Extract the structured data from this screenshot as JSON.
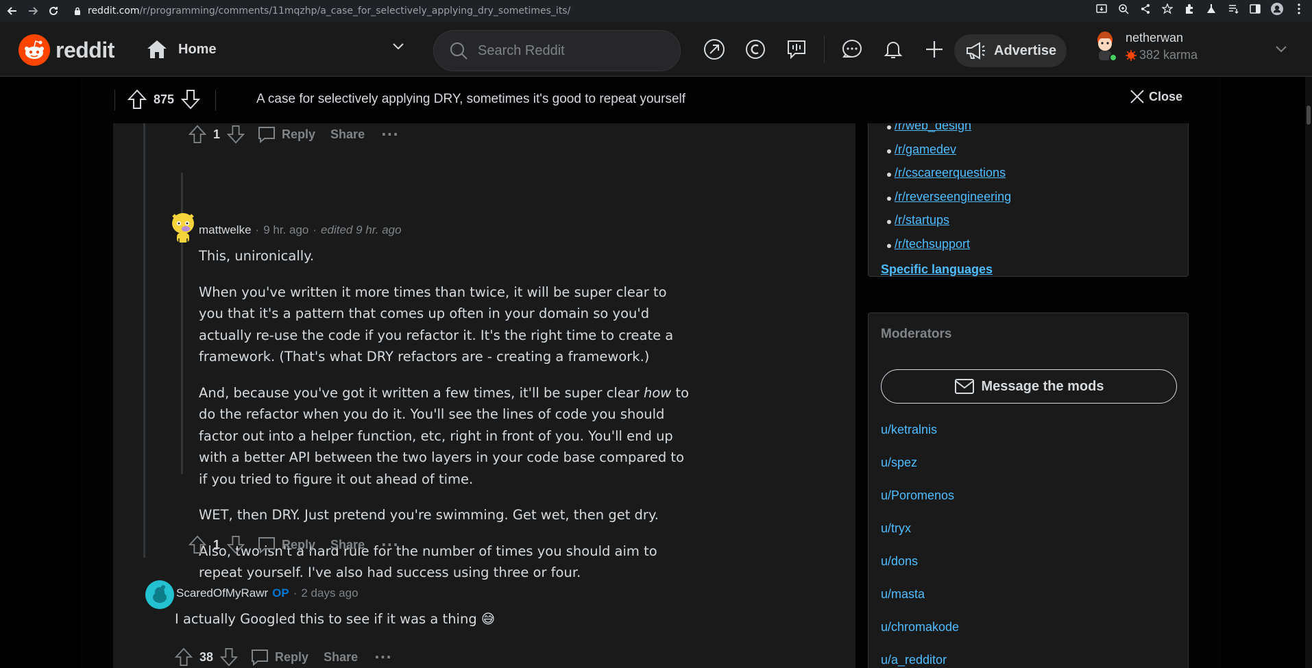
{
  "browser": {
    "url_host": "reddit.com",
    "url_path": "/r/programming/comments/11mqzhp/a_case_for_selectively_applying_dry_sometimes_its/"
  },
  "header": {
    "logo_text": "reddit",
    "feed_label": "Home",
    "search_placeholder": "Search Reddit",
    "advertise_label": "Advertise",
    "username": "netherwan",
    "karma": "382 karma"
  },
  "post": {
    "score": "875",
    "title": "A case for selectively applying DRY, sometimes it's good to repeat yourself",
    "close_label": "Close"
  },
  "comments": [
    {
      "score": "1",
      "reply": "Reply",
      "share": "Share",
      "more": "···"
    },
    {
      "author": "mattwelke",
      "time": "9 hr. ago",
      "edited": "edited 9 hr. ago",
      "paragraphs": [
        "This, unironically.",
        "When you've written it more times than twice, it will be super clear to you that it's a pattern that comes up often in your domain so you'd actually re-use the code if you refactor it. It's the right time to create a framework. (That's what DRY refactors are - creating a framework.)",
        "WET, then DRY. Just pretend you're swimming. Get wet, then get dry.",
        "Also, two isn't a hard rule for the number of times you should aim to repeat yourself. I've also had success using three or four."
      ],
      "para3_pre": "And, because you've got it written a few times, it'll be super clear ",
      "para3_em": "how",
      "para3_post": " to do the refactor when you do it. You'll see the lines of code you should factor out into a helper function, etc, right in front of you. You'll end up with a better API between the two layers in your code base compared to if you tried to figure it out ahead of time.",
      "score": "1",
      "reply": "Reply",
      "share": "Share",
      "more": "···"
    },
    {
      "author": "ScaredOfMyRawr",
      "op": "OP",
      "time": "2 days ago",
      "text": "I actually Googled this to see if it was a thing 😅",
      "score": "38",
      "reply": "Reply",
      "share": "Share",
      "more": "···"
    }
  ],
  "sidebar": {
    "links": [
      "/r/web_design",
      "/r/gamedev",
      "/r/cscareerquestions",
      "/r/reverseengineering",
      "/r/startups",
      "/r/techsupport"
    ],
    "specific_languages": "Specific languages",
    "moderators_title": "Moderators",
    "message_mods": "Message the mods",
    "mods": [
      "u/ketralnis",
      "u/spez",
      "u/Poromenos",
      "u/tryx",
      "u/dons",
      "u/masta",
      "u/chromakode",
      "u/a_redditor"
    ]
  },
  "colors": {
    "accent": "#ff4500",
    "link": "#4fbcff",
    "op": "#0079d3",
    "bg": "#1a1a1b"
  }
}
